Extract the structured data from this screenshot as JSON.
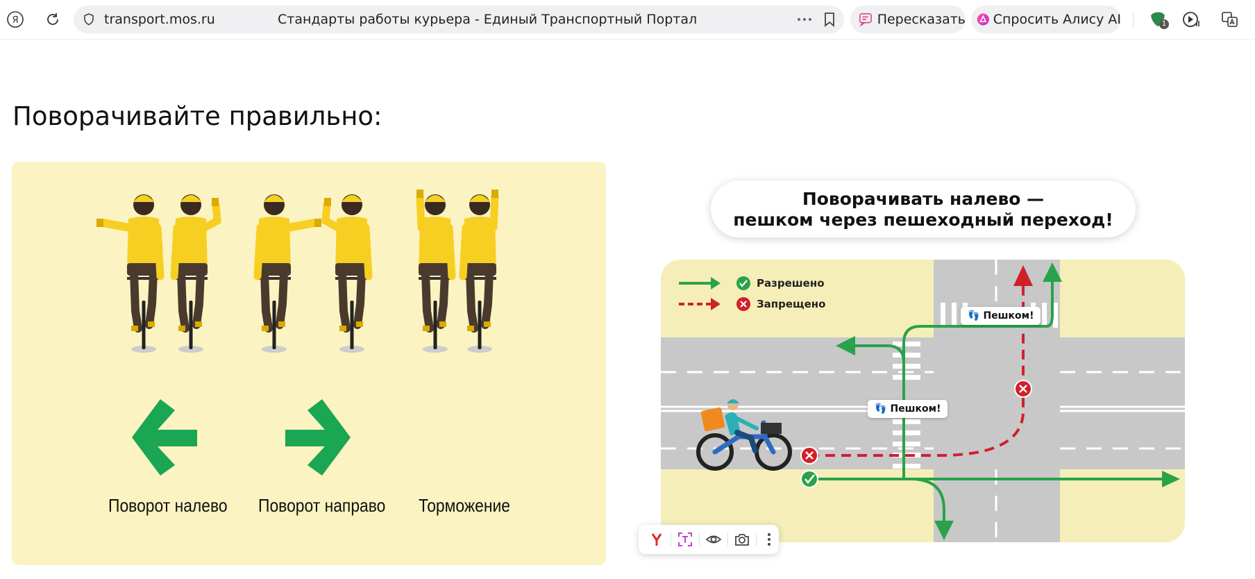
{
  "browser": {
    "url": "transport.mos.ru",
    "tab_title": "Стандарты работы курьера - Единый Транспортный Портал",
    "retell_label": "Пересказать",
    "ask_alice_label": "Спросить Алису AI",
    "extension_badge": "1",
    "icons": [
      "yandex-logo-icon",
      "reload-icon",
      "shield-icon",
      "more-dots-icon",
      "bookmark-icon",
      "retell-icon",
      "alice-icon",
      "extension-icon",
      "player-icon",
      "translate-icon"
    ]
  },
  "page": {
    "heading": "Поворачивайте правильно:"
  },
  "signals": {
    "captions": [
      "Поворот налево",
      "Поворот направо",
      "Торможение"
    ],
    "colors": {
      "panel": "#fbf3c1",
      "arrow": "#1aa652",
      "jersey": "#f7cf23"
    }
  },
  "diagram": {
    "title_line1": "Поворачивать налево —",
    "title_line2": "пешком через пешеходный переход!",
    "legend": {
      "allowed": "Разрешено",
      "forbidden": "Запрещено"
    },
    "walk_label": "Пешком!",
    "colors": {
      "allowed": "#2aa24a",
      "forbidden": "#d0202a",
      "road": "#c8c8c8",
      "sidewalk": "#f5eeb8"
    }
  },
  "image_toolbar": {
    "icons": [
      "yandex-search-icon",
      "text-recognition-icon",
      "eye-icon",
      "camera-icon",
      "more-vertical-icon"
    ]
  }
}
